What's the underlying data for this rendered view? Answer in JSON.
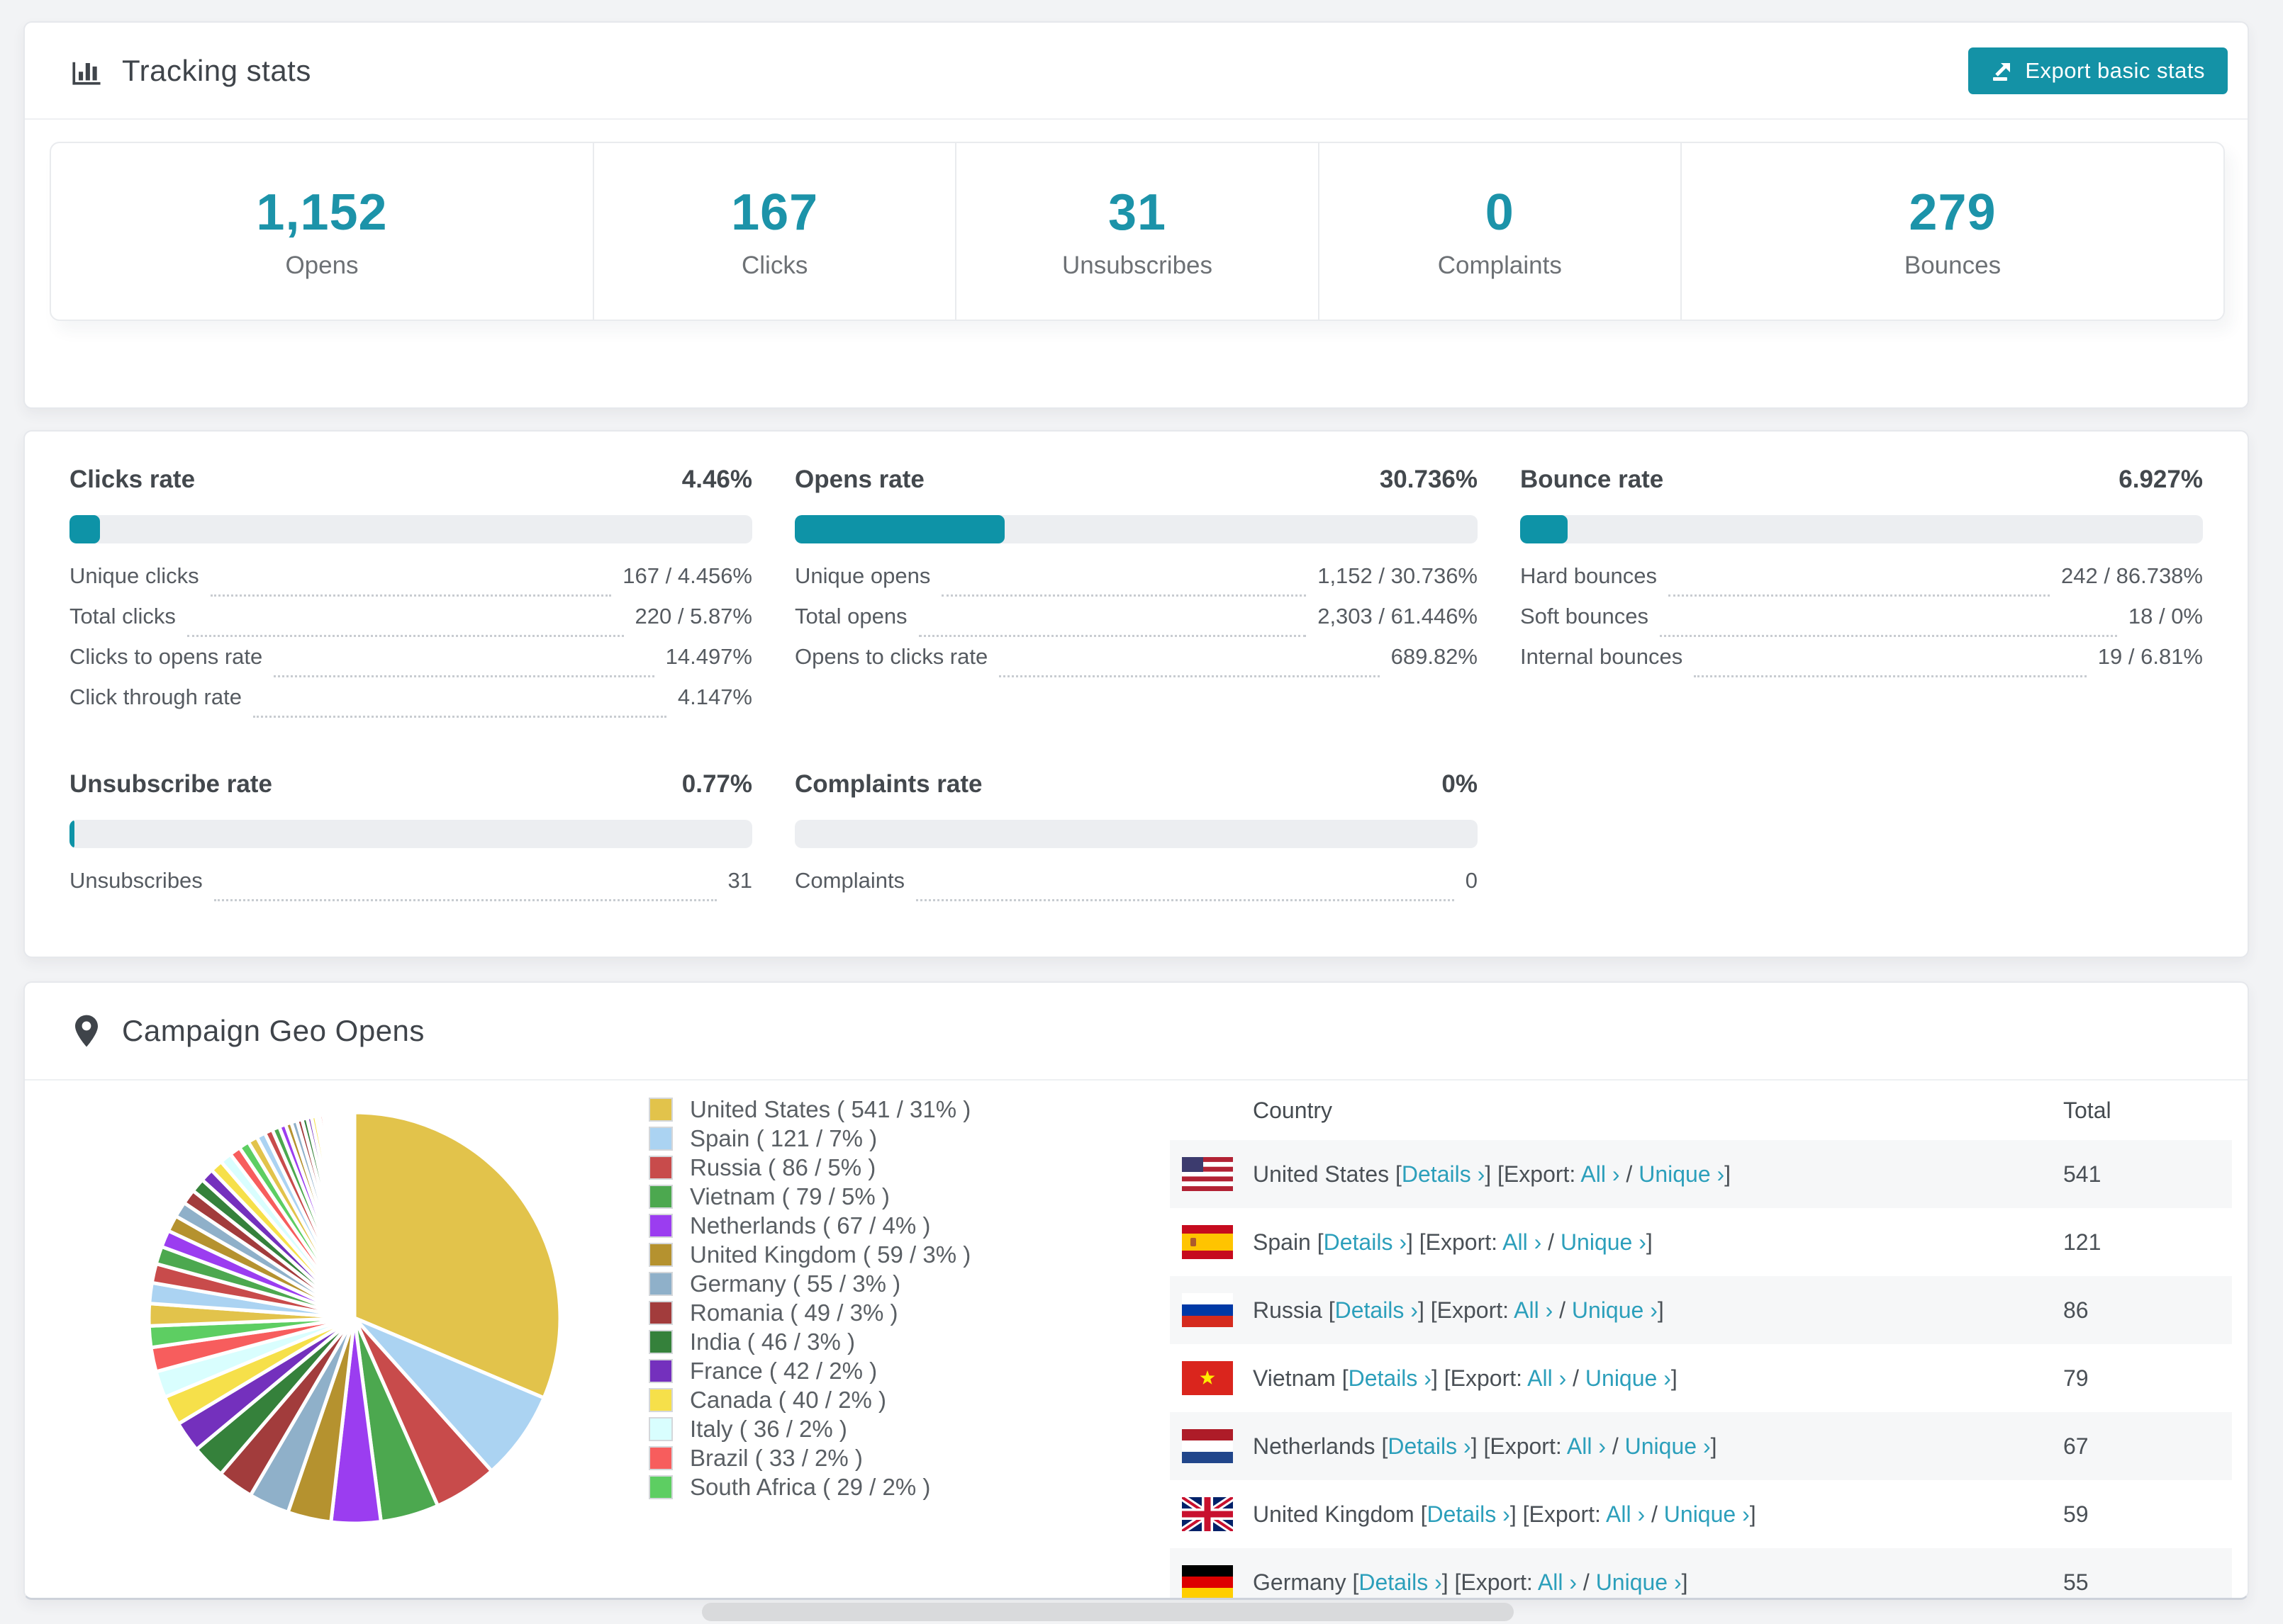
{
  "colors": {
    "accent_teal": "#0e93a7",
    "number_teal": "#1c93a9",
    "button_teal": "#1492a6",
    "link_teal": "#2c9fbb",
    "bar_track": "#eceef1",
    "row_stripe": "#f6f7f8"
  },
  "tracking": {
    "title": "Tracking stats",
    "export_button": {
      "label": "Export basic stats"
    },
    "stats": [
      {
        "value": "1,152",
        "label": "Opens"
      },
      {
        "value": "167",
        "label": "Clicks"
      },
      {
        "value": "31",
        "label": "Unsubscribes"
      },
      {
        "value": "0",
        "label": "Complaints"
      },
      {
        "value": "279",
        "label": "Bounces"
      }
    ]
  },
  "rates": {
    "cards": [
      {
        "title": "Clicks rate",
        "value": "4.46%",
        "percent": 4.46,
        "rows": [
          {
            "label": "Unique clicks",
            "value": "167 / 4.456%"
          },
          {
            "label": "Total clicks",
            "value": "220 / 5.87%"
          },
          {
            "label": "Clicks to opens rate",
            "value": "14.497%"
          },
          {
            "label": "Click through rate",
            "value": "4.147%"
          }
        ]
      },
      {
        "title": "Opens rate",
        "value": "30.736%",
        "percent": 30.736,
        "rows": [
          {
            "label": "Unique opens",
            "value": "1,152 / 30.736%"
          },
          {
            "label": "Total opens",
            "value": "2,303 / 61.446%"
          },
          {
            "label": "Opens to clicks rate",
            "value": "689.82%"
          }
        ]
      },
      {
        "title": "Bounce rate",
        "value": "6.927%",
        "percent": 6.927,
        "rows": [
          {
            "label": "Hard bounces",
            "value": "242 / 86.738%"
          },
          {
            "label": "Soft bounces",
            "value": "18 / 0%"
          },
          {
            "label": "Internal bounces",
            "value": "19 / 6.81%"
          }
        ]
      },
      {
        "title": "Unsubscribe rate",
        "value": "0.77%",
        "percent": 0.77,
        "rows": [
          {
            "label": "Unsubscribes",
            "value": "31"
          }
        ]
      },
      {
        "title": "Complaints rate",
        "value": "0%",
        "percent": 0,
        "rows": [
          {
            "label": "Complaints",
            "value": "0"
          }
        ]
      }
    ]
  },
  "geo": {
    "title": "Campaign Geo Opens",
    "chart_data": {
      "type": "pie",
      "title": "Campaign Geo Opens",
      "labels": [
        "United States",
        "Spain",
        "Russia",
        "Vietnam",
        "Netherlands",
        "United Kingdom",
        "Germany",
        "Romania",
        "India",
        "France",
        "Canada",
        "Italy",
        "Brazil",
        "South Africa"
      ],
      "values": [
        541,
        121,
        86,
        79,
        67,
        59,
        55,
        49,
        46,
        42,
        40,
        36,
        33,
        29
      ],
      "percents": [
        31,
        7,
        5,
        5,
        4,
        3,
        3,
        3,
        3,
        2,
        2,
        2,
        2,
        2
      ],
      "others_values": [
        30,
        28,
        26,
        24,
        23,
        22,
        21,
        20,
        19,
        18,
        17,
        16,
        15,
        14,
        13,
        12,
        11,
        10,
        9,
        8,
        8,
        7,
        7,
        6,
        6,
        5,
        5,
        4,
        4,
        4,
        3,
        3,
        3,
        2,
        2,
        2,
        2,
        1,
        1,
        1,
        1,
        1,
        1,
        1,
        1,
        1,
        1,
        1,
        1,
        1
      ],
      "colors": [
        "#e2c34b",
        "#abd3f2",
        "#c84b4b",
        "#4ca84f",
        "#9b3df0",
        "#b5922f",
        "#8fb0c9",
        "#a23c3c",
        "#35813b",
        "#7430bd",
        "#f6e04a",
        "#d9fefe",
        "#f75d5d",
        "#5dce62"
      ],
      "start_angle_deg": -90,
      "direction": "clockwise",
      "legend_position": "right"
    },
    "legend": [
      {
        "text": "United States ( 541 / 31% )",
        "color": "#e2c34b"
      },
      {
        "text": "Spain ( 121 / 7% )",
        "color": "#abd3f2"
      },
      {
        "text": "Russia ( 86 / 5% )",
        "color": "#c84b4b"
      },
      {
        "text": "Vietnam ( 79 / 5% )",
        "color": "#4ca84f"
      },
      {
        "text": "Netherlands ( 67 / 4% )",
        "color": "#9b3df0"
      },
      {
        "text": "United Kingdom ( 59 / 3% )",
        "color": "#b5922f"
      },
      {
        "text": "Germany ( 55 / 3% )",
        "color": "#8fb0c9"
      },
      {
        "text": "Romania ( 49 / 3% )",
        "color": "#a23c3c"
      },
      {
        "text": "India ( 46 / 3% )",
        "color": "#35813b"
      },
      {
        "text": "France ( 42 / 2% )",
        "color": "#7430bd"
      },
      {
        "text": "Canada ( 40 / 2% )",
        "color": "#f6e04a"
      },
      {
        "text": "Italy ( 36 / 2% )",
        "color": "#d9fefe"
      },
      {
        "text": "Brazil ( 33 / 2% )",
        "color": "#f75d5d"
      },
      {
        "text": "South Africa ( 29 / 2% )",
        "color": "#5dce62"
      }
    ],
    "table": {
      "headers": [
        "Country",
        "Total"
      ],
      "export_prefix": "Export:",
      "links": {
        "details": "Details ›",
        "all": "All ›",
        "unique": "Unique ›"
      },
      "rows": [
        {
          "country": "United States",
          "flag": "us",
          "total": "541"
        },
        {
          "country": "Spain",
          "flag": "es",
          "total": "121"
        },
        {
          "country": "Russia",
          "flag": "ru",
          "total": "86"
        },
        {
          "country": "Vietnam",
          "flag": "vn",
          "total": "79"
        },
        {
          "country": "Netherlands",
          "flag": "nl",
          "total": "67"
        },
        {
          "country": "United Kingdom",
          "flag": "gb",
          "total": "59"
        },
        {
          "country": "Germany",
          "flag": "de",
          "total": "55"
        }
      ]
    }
  }
}
